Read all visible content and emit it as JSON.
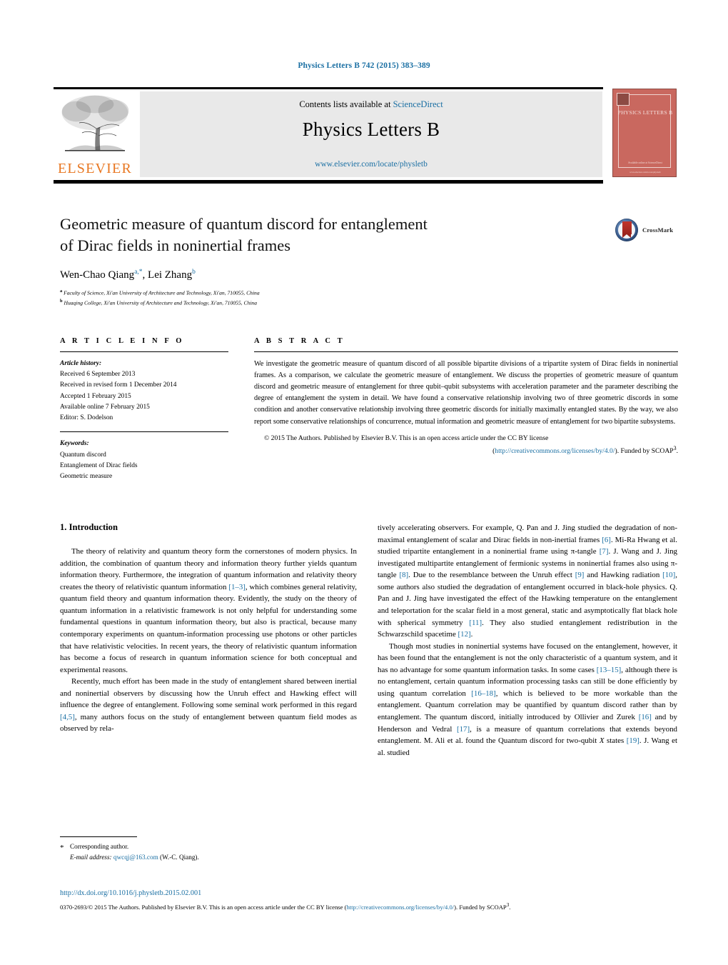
{
  "running_head": "Physics Letters B 742 (2015) 383–389",
  "masthead": {
    "contents_prefix": "Contents lists available at ",
    "contents_link": "ScienceDirect",
    "journal_title": "Physics Letters B",
    "journal_url": "www.elsevier.com/locate/physletb",
    "publisher_name": "ELSEVIER",
    "publisher_logo_icon": "elsevier-tree-icon",
    "cover": {
      "title": "PHYSICS LETTERS B",
      "footer_text": "Available online at\nScienceDirect",
      "bottom_text": "www.elsevier.com/locate/physletb"
    },
    "band_color": "#e9e9e9",
    "link_color": "#1a6fa3",
    "cover_color": "#c9685f",
    "brand_color": "#e87722"
  },
  "article": {
    "title_line1": "Geometric measure of quantum discord for entanglement",
    "title_line2": "of Dirac fields in noninertial frames",
    "authors_part1": "Wen-Chao Qiang",
    "authors_sup1": "a,*",
    "authors_sep": ", ",
    "authors_part2": "Lei Zhang",
    "authors_sup2": "b",
    "affiliation_a_marker": "a",
    "affiliation_a": "Faculty of Science, Xi'an University of Architecture and Technology, Xi'an, 710055, China",
    "affiliation_b_marker": "b",
    "affiliation_b": "Huaqing College, Xi'an University of Architecture and Technology, Xi'an, 710055, China",
    "crossmark_label": "CrossMark",
    "crossmark_icon": "crossmark-logo-icon"
  },
  "info": {
    "heading": "A R T I C L E    I N F O",
    "history_label": "Article history:",
    "history": [
      "Received 6 September 2013",
      "Received in revised form 1 December 2014",
      "Accepted 1 February 2015",
      "Available online 7 February 2015",
      "Editor: S. Dodelson"
    ],
    "keywords_label": "Keywords:",
    "keywords": [
      "Quantum discord",
      "Entanglement of Dirac fields",
      "Geometric measure"
    ]
  },
  "abstract": {
    "heading": "A B S T R A C T",
    "text": "We investigate the geometric measure of quantum discord of all possible bipartite divisions of a tripartite system of Dirac fields in noninertial frames. As a comparison, we calculate the geometric measure of entanglement. We discuss the properties of geometric measure of quantum discord and geometric measure of entanglement for three qubit–qubit subsystems with acceleration parameter and the parameter describing the degree of entanglement the system in detail. We have found a conservative relationship involving two of three geometric discords in some condition and another conservative relationship involving three geometric discords for initially maximally entangled states. By the way, we also report some conservative relationships of concurrence, mutual information and geometric measure of entanglement for two bipartite subsystems.",
    "copyright_line1": "© 2015 The Authors. Published by Elsevier B.V. This is an open access article under the CC BY license",
    "copyright_link": "http://creativecommons.org/licenses/by/4.0/",
    "copyright_line2_pre": "(",
    "copyright_line2_post": "). Funded by SCOAP",
    "copyright_sup": "3",
    "copyright_end": "."
  },
  "body": {
    "section_heading": "1. Introduction",
    "left_paragraphs": [
      "The theory of relativity and quantum theory form the cornerstones of modern physics. In addition, the combination of quantum theory and information theory further yields quantum information theory. Furthermore, the integration of quantum information and relativity theory creates the theory of relativistic quantum information [1–3], which combines general relativity, quantum field theory and quantum information theory. Evidently, the study on the theory of quantum information in a relativistic framework is not only helpful for understanding some fundamental questions in quantum information theory, but also is practical, because many contemporary experiments on quantum-information processing use photons or other particles that have relativistic velocities. In recent years, the theory of relativistic quantum information has become a focus of research in quantum information science for both conceptual and experimental reasons.",
      "Recently, much effort has been made in the study of entanglement shared between inertial and noninertial observers by discussing how the Unruh effect and Hawking effect will influence the degree of entanglement. Following some seminal work performed in this regard [4,5], many authors focus on the study of entanglement between quantum field modes as observed by rela-"
    ],
    "right_paragraphs": [
      "tively accelerating observers. For example, Q. Pan and J. Jing studied the degradation of non-maximal entanglement of scalar and Dirac fields in non-inertial frames [6]. Mi-Ra Hwang et al. studied tripartite entanglement in a noninertial frame using π-tangle [7]. J. Wang and J. Jing investigated multipartite entanglement of fermionic systems in noninertial frames also using π-tangle [8]. Due to the resemblance between the Unruh effect [9] and Hawking radiation [10], some authors also studied the degradation of entanglement occurred in black-hole physics. Q. Pan and J. Jing have investigated the effect of the Hawking temperature on the entanglement and teleportation for the scalar field in a most general, static and asymptotically flat black hole with spherical symmetry [11]. They also studied entanglement redistribution in the Schwarzschild spacetime [12].",
      "Though most studies in noninertial systems have focused on the entanglement, however, it has been found that the entanglement is not the only characteristic of a quantum system, and it has no advantage for some quantum information tasks. In some cases [13–15], although there is no entanglement, certain quantum information processing tasks can still be done efficiently by using quantum correlation [16–18], which is believed to be more workable than the entanglement. Quantum correlation may be quantified by quantum discord rather than by entanglement. The quantum discord, initially introduced by Ollivier and Zurek [16] and by Henderson and Vedral [17], is a measure of quantum correlations that extends beyond entanglement. M. Ali et al. found the Quantum discord for two-qubit X states [19]. J. Wang et al. studied"
    ]
  },
  "footer": {
    "corresponding_marker": "*",
    "corresponding_label": "Corresponding author.",
    "email_label": "E-mail address:",
    "email_address": "qwcqj@163.com",
    "email_owner": "(W.-C. Qiang).",
    "doi": "http://dx.doi.org/10.1016/j.physletb.2015.02.001",
    "issn_copyright": "0370-2693/© 2015 The Authors. Published by Elsevier B.V. This is an open access article under the CC BY license (",
    "issn_link": "http://creativecommons.org/licenses/by/4.0/",
    "issn_copyright_tail": "). Funded by ",
    "scoap": "SCOAP",
    "scoap_sup": "3",
    "scoap_end": "."
  }
}
